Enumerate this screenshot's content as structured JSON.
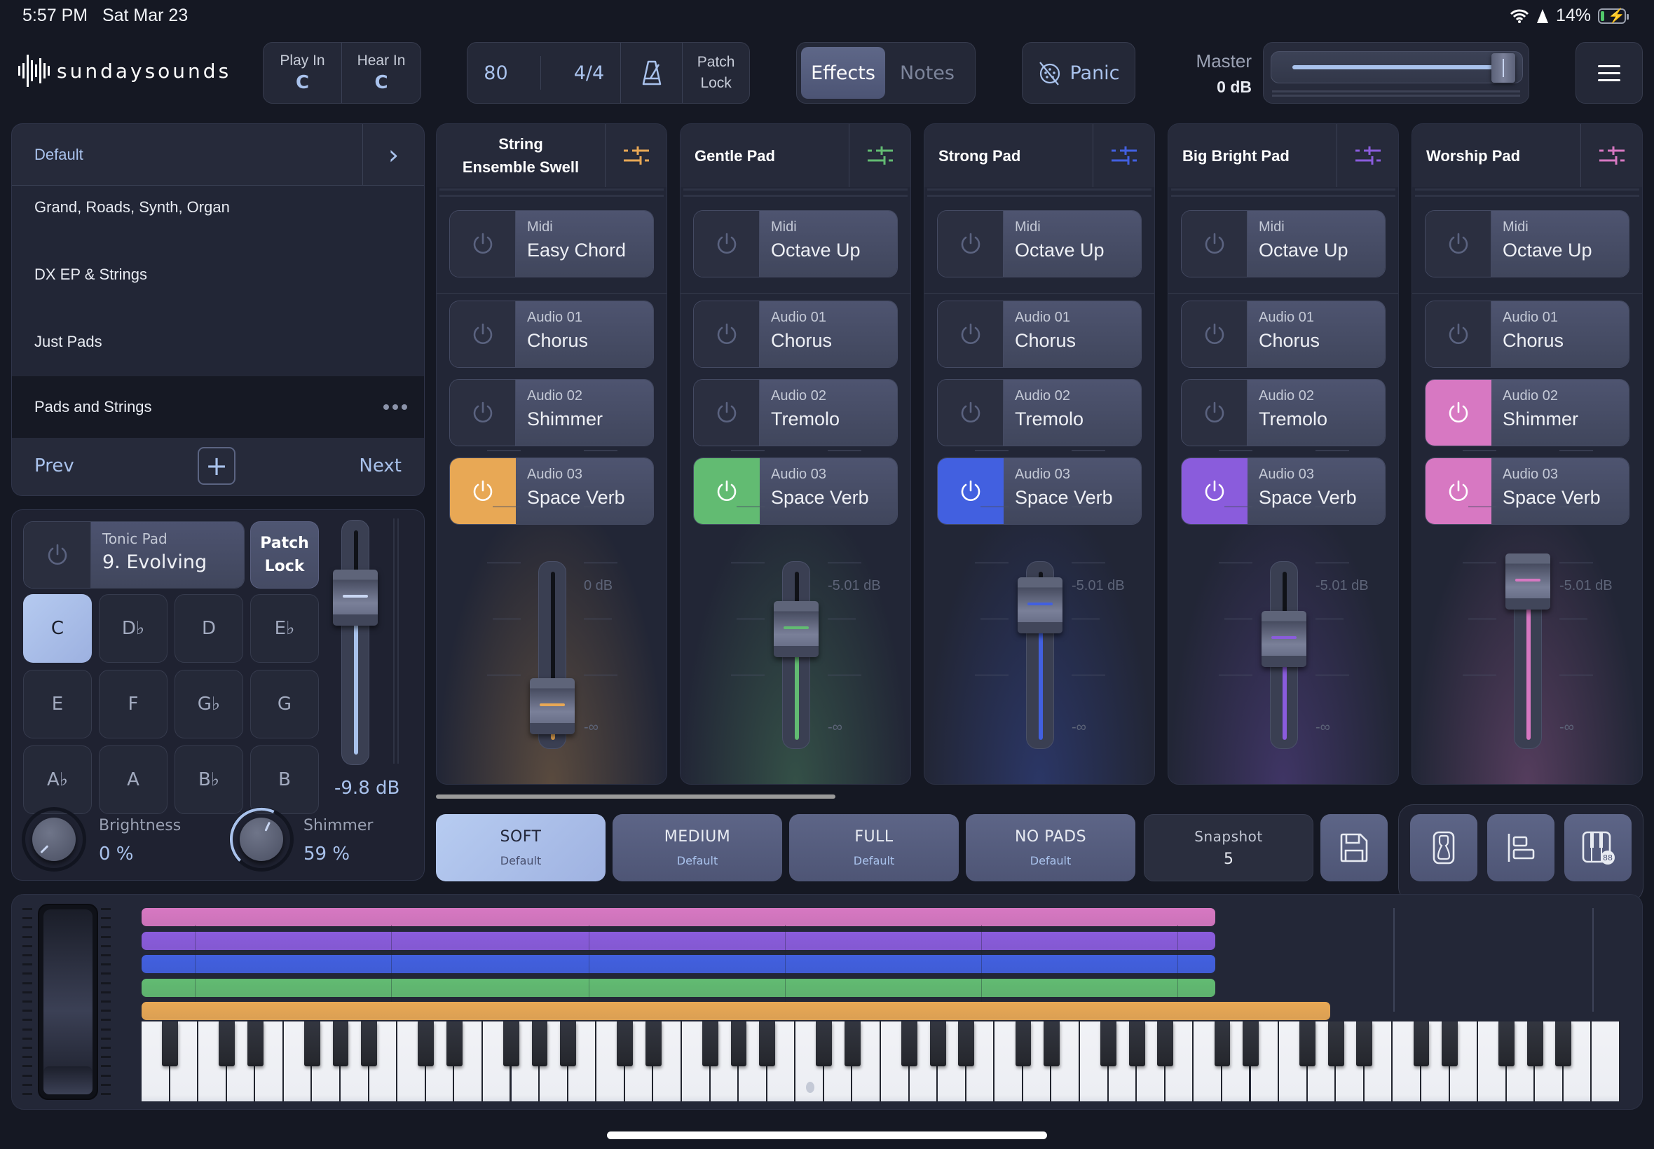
{
  "status_bar": {
    "time": "5:57 PM",
    "date": "Sat Mar 23",
    "battery": "14%"
  },
  "app": {
    "logo_text": "sundaysounds"
  },
  "header": {
    "play_in": {
      "label": "Play In",
      "value": "C"
    },
    "hear_in": {
      "label": "Hear In",
      "value": "C"
    },
    "tempo": "80",
    "time_signature": "4/4",
    "metronome_icon": "metronome-icon",
    "patch_lock": {
      "line1": "Patch",
      "line2": "Lock"
    },
    "tabs": [
      {
        "label": "Effects",
        "active": true
      },
      {
        "label": "Notes",
        "active": false
      }
    ],
    "panic_label": "Panic",
    "master": {
      "label": "Master",
      "value": "0 dB",
      "level_fraction": 1.0
    }
  },
  "presets": {
    "current": "Default",
    "items": [
      "Grand, Roads, Synth, Organ",
      "DX EP & Strings",
      "Just Pads"
    ],
    "selected": "Pads and Strings",
    "prev_label": "Prev",
    "next_label": "Next"
  },
  "tonic": {
    "label": "Tonic Pad",
    "value": "9. Evolving",
    "patch_lock": {
      "line1": "Patch",
      "line2": "Lock"
    },
    "keys": [
      "C",
      "D♭",
      "D",
      "E♭",
      "E",
      "F",
      "G♭",
      "G",
      "A♭",
      "A",
      "B♭",
      "B"
    ],
    "active_key": "C",
    "volume": "-9.8 dB",
    "volume_fraction": 0.7,
    "accent": "#a9c2ec",
    "knobs": [
      {
        "label": "Brightness",
        "value": "0 %",
        "fraction": 0.0
      },
      {
        "label": "Shimmer",
        "value": "59 %",
        "fraction": 0.59
      }
    ]
  },
  "channels": [
    {
      "name": "String Ensemble Swell",
      "color": "#e8a855",
      "db_label": "0 dB",
      "min_label": "-∞",
      "fader_fraction": 0.2,
      "effects": [
        {
          "cat": "Midi",
          "name": "Easy Chord",
          "on": false
        },
        {
          "cat": "Audio 01",
          "name": "Chorus",
          "on": false
        },
        {
          "cat": "Audio 02",
          "name": "Shimmer",
          "on": false
        },
        {
          "cat": "Audio 03",
          "name": "Space Verb",
          "on": true
        }
      ]
    },
    {
      "name": "Gentle Pad",
      "color": "#62bb72",
      "db_label": "-5.01 dB",
      "min_label": "-∞",
      "fader_fraction": 0.66,
      "effects": [
        {
          "cat": "Midi",
          "name": "Octave Up",
          "on": false
        },
        {
          "cat": "Audio 01",
          "name": "Chorus",
          "on": false
        },
        {
          "cat": "Audio 02",
          "name": "Tremolo",
          "on": false
        },
        {
          "cat": "Audio 03",
          "name": "Space Verb",
          "on": true
        }
      ]
    },
    {
      "name": "Strong Pad",
      "color": "#4260e0",
      "db_label": "-5.01 dB",
      "min_label": "-∞",
      "fader_fraction": 0.8,
      "effects": [
        {
          "cat": "Midi",
          "name": "Octave Up",
          "on": false
        },
        {
          "cat": "Audio 01",
          "name": "Chorus",
          "on": false
        },
        {
          "cat": "Audio 02",
          "name": "Tremolo",
          "on": false
        },
        {
          "cat": "Audio 03",
          "name": "Space Verb",
          "on": true
        }
      ]
    },
    {
      "name": "Big Bright Pad",
      "color": "#8a5cdc",
      "db_label": "-5.01 dB",
      "min_label": "-∞",
      "fader_fraction": 0.6,
      "effects": [
        {
          "cat": "Midi",
          "name": "Octave Up",
          "on": false
        },
        {
          "cat": "Audio 01",
          "name": "Chorus",
          "on": false
        },
        {
          "cat": "Audio 02",
          "name": "Tremolo",
          "on": false
        },
        {
          "cat": "Audio 03",
          "name": "Space Verb",
          "on": true
        }
      ]
    },
    {
      "name": "Worship Pad",
      "color": "#d778c2",
      "db_label": "-5.01 dB",
      "min_label": "-∞",
      "fader_fraction": 0.94,
      "effects": [
        {
          "cat": "Midi",
          "name": "Octave Up",
          "on": false
        },
        {
          "cat": "Audio 01",
          "name": "Chorus",
          "on": false
        },
        {
          "cat": "Audio 02",
          "name": "Shimmer",
          "on": true
        },
        {
          "cat": "Audio 03",
          "name": "Space Verb",
          "on": true
        }
      ]
    }
  ],
  "snapshots": {
    "buttons": [
      {
        "name": "SOFT",
        "sub": "Default",
        "active": true
      },
      {
        "name": "MEDIUM",
        "sub": "Default",
        "active": false
      },
      {
        "name": "FULL",
        "sub": "Default",
        "active": false
      },
      {
        "name": "NO PADS",
        "sub": "Default",
        "active": false
      }
    ],
    "snapshot_label": "Snapshot",
    "snapshot_value": "5"
  },
  "tool_buttons": [
    "sustain-pedal-icon",
    "align-left-icon",
    "piano-88-icon"
  ],
  "piano_badge": "88",
  "keyboard": {
    "white_keys": 52,
    "first_note": "A0",
    "note_ranges": [
      {
        "color": "#d778c2",
        "range_fraction": 0.726
      },
      {
        "color": "#8a5cdc",
        "range_fraction": 0.726
      },
      {
        "color": "#4260e0",
        "range_fraction": 0.726
      },
      {
        "color": "#62bb72",
        "range_fraction": 0.726
      },
      {
        "color": "#e8a855",
        "range_fraction": 0.804
      }
    ]
  }
}
